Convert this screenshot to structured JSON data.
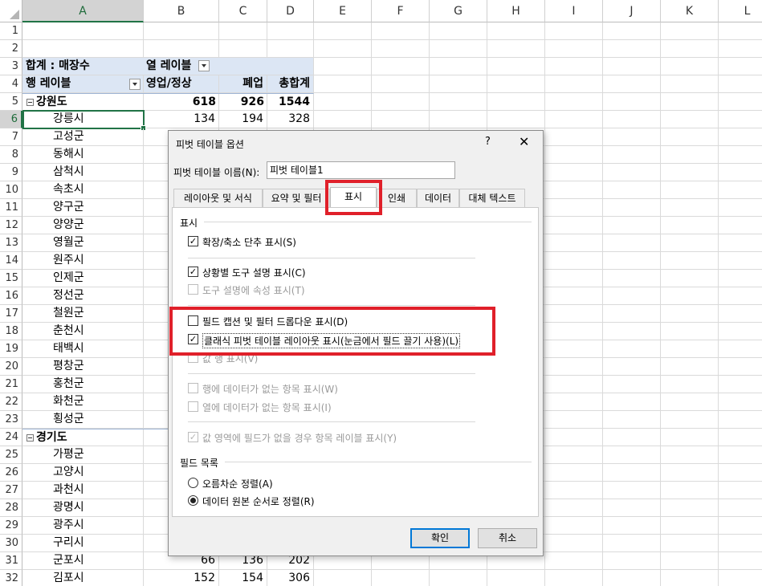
{
  "columns": [
    "A",
    "B",
    "C",
    "D",
    "E",
    "F",
    "G",
    "H",
    "I",
    "J",
    "K",
    "L"
  ],
  "selected_column": "A",
  "selected_row": "6",
  "rows": [
    "1",
    "2",
    "3",
    "4",
    "5",
    "6",
    "7",
    "8",
    "9",
    "10",
    "11",
    "12",
    "13",
    "14",
    "15",
    "16",
    "17",
    "18",
    "19",
    "20",
    "21",
    "22",
    "23",
    "24",
    "25",
    "26",
    "27",
    "28",
    "29",
    "30",
    "31",
    "32"
  ],
  "pivot": {
    "r3_a": "합계 : 매장수",
    "r3_b": "열 레이블",
    "r4_a": "행 레이블",
    "r4_b": "영업/정상",
    "r4_c": "폐업",
    "r4_d": "총합계",
    "group1": {
      "name": "강원도",
      "b": "618",
      "c": "926",
      "d": "1544"
    },
    "r6": {
      "name": "강릉시",
      "b": "134",
      "c": "194",
      "d": "328"
    },
    "list1": [
      "고성군",
      "동해시",
      "삼척시",
      "속초시",
      "양구군",
      "양양군",
      "영월군",
      "원주시",
      "인제군",
      "정선군",
      "철원군",
      "춘천시",
      "태백시",
      "평창군",
      "홍천군",
      "화천군",
      "횡성군"
    ],
    "group2": {
      "name": "경기도"
    },
    "list2": [
      "가평군",
      "고양시",
      "과천시",
      "광명시",
      "광주시",
      "구리시"
    ],
    "r31": {
      "name": "군포시",
      "b": "66",
      "c": "136",
      "d": "202"
    },
    "r32": {
      "name": "김포시",
      "b": "152",
      "c": "154",
      "d": "306"
    }
  },
  "dialog": {
    "title": "피벗 테이블 옵션",
    "help": "?",
    "close": "✕",
    "name_label": "피벗 테이블 이름(N):",
    "name_value": "피벗 테이블1",
    "tabs": [
      "레이아웃 및 서식",
      "요약 및 필터",
      "표시",
      "인쇄",
      "데이터",
      "대체 텍스트"
    ],
    "active_tab": "표시",
    "section_display": "표시",
    "opt_expand": "확장/축소 단추 표시(S)",
    "opt_tooltip": "상황별 도구 설명 표시(C)",
    "opt_props": "도구 설명에 속성 표시(T)",
    "opt_captions": "필드 캡션 및 필터 드롭다운 표시(D)",
    "opt_classic": "클래식 피벗 테이블 레이아웃 표시(눈금에서 필드 끌기 사용)(L)",
    "opt_values_row": "값 행 표시(V)",
    "opt_items_rows": "행에 데이터가 없는 항목 표시(W)",
    "opt_items_cols": "열에 데이터가 없는 항목 표시(I)",
    "opt_item_labels": "값 영역에 필드가 없을 경우 항목 레이블 표시(Y)",
    "section_fieldlist": "필드 목록",
    "sort_az": "오름차순 정렬(A)",
    "sort_source": "데이터 원본 순서로 정렬(R)",
    "ok": "확인",
    "cancel": "취소"
  },
  "highlight_color": "#e0202a"
}
